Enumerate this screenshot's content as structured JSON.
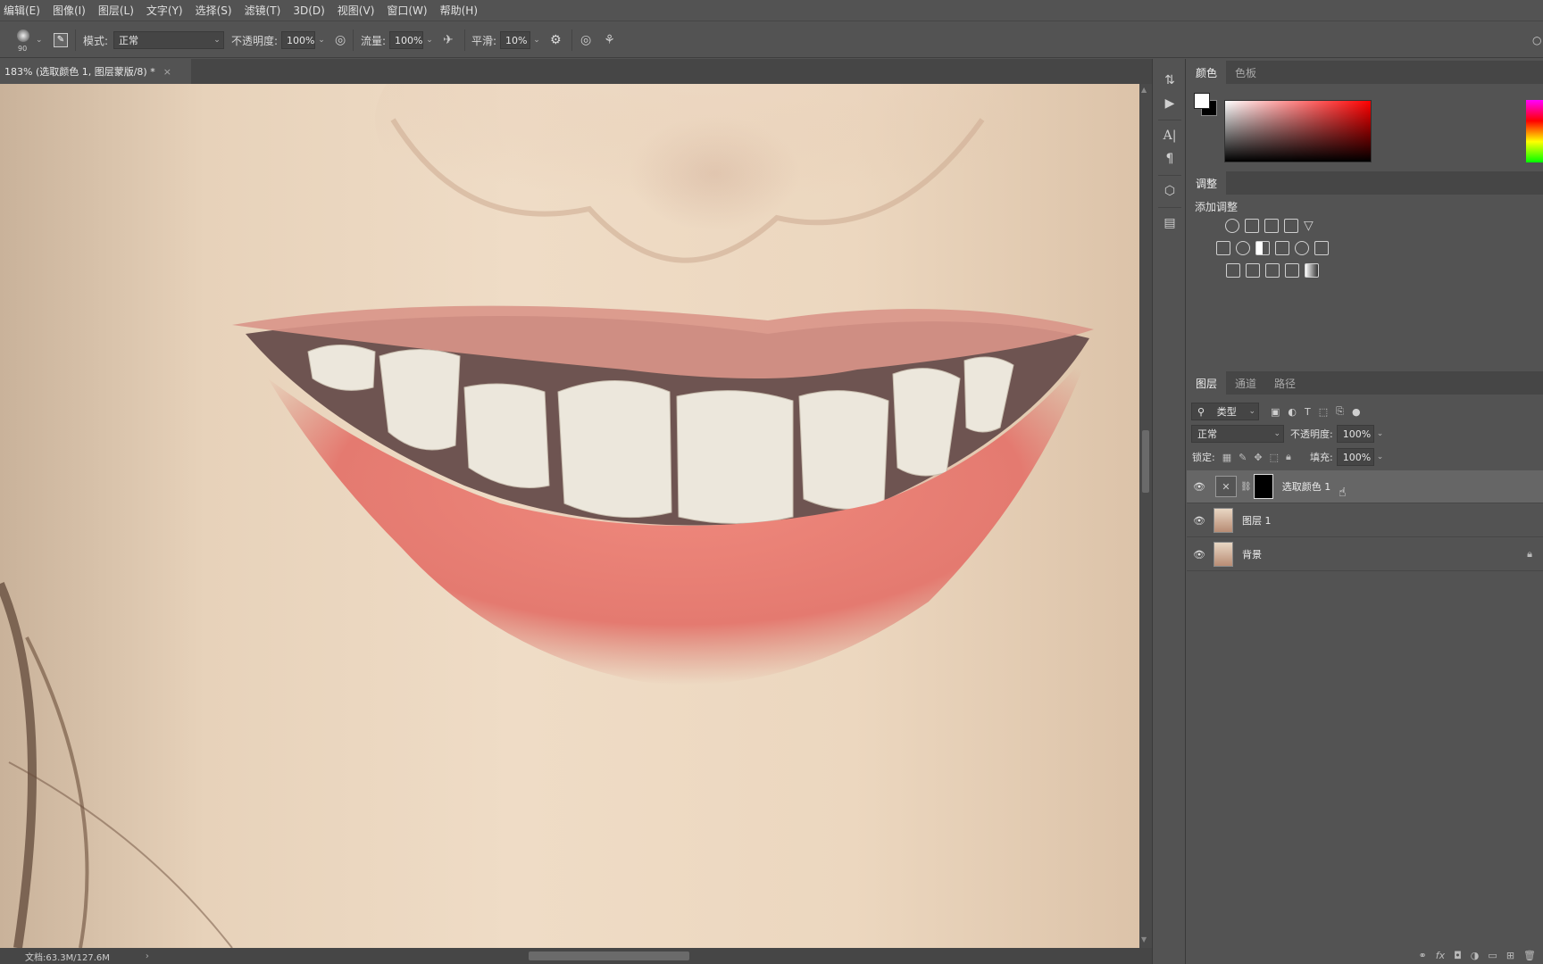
{
  "menu": [
    "编辑(E)",
    "图像(I)",
    "图层(L)",
    "文字(Y)",
    "选择(S)",
    "滤镜(T)",
    "3D(D)",
    "视图(V)",
    "窗口(W)",
    "帮助(H)"
  ],
  "options": {
    "brush_size": "90",
    "mode_label": "模式:",
    "mode_value": "正常",
    "opacity_label": "不透明度:",
    "opacity_value": "100%",
    "flow_label": "流量:",
    "flow_value": "100%",
    "smooth_label": "平滑:",
    "smooth_value": "10%"
  },
  "document": {
    "tab_title": "183% (选取颜色 1, 图层蒙版/8) *",
    "close": "×",
    "status": "文档:63.3M/127.6M",
    "status_arrow": "›"
  },
  "color_panel": {
    "tabs": [
      "颜色",
      "色板"
    ],
    "foreground": "#ffffff",
    "background": "#000000"
  },
  "adjustments_panel": {
    "tab": "调整",
    "title": "添加调整"
  },
  "layers_panel": {
    "tabs": [
      "图层",
      "通道",
      "路径"
    ],
    "filter_label": "类型",
    "blend_mode": "正常",
    "opacity_label": "不透明度:",
    "opacity_value": "100%",
    "lock_label": "锁定:",
    "fill_label": "填充:",
    "fill_value": "100%",
    "layers": [
      {
        "name": "选取颜色 1",
        "type": "adjustment",
        "selected": true
      },
      {
        "name": "图层 1",
        "type": "image",
        "selected": false
      },
      {
        "name": "背景",
        "type": "image",
        "selected": false,
        "locked": true
      }
    ]
  },
  "colors": {
    "ui_bg": "#535353",
    "panel_dark": "#464646",
    "selected_layer": "#666666"
  }
}
